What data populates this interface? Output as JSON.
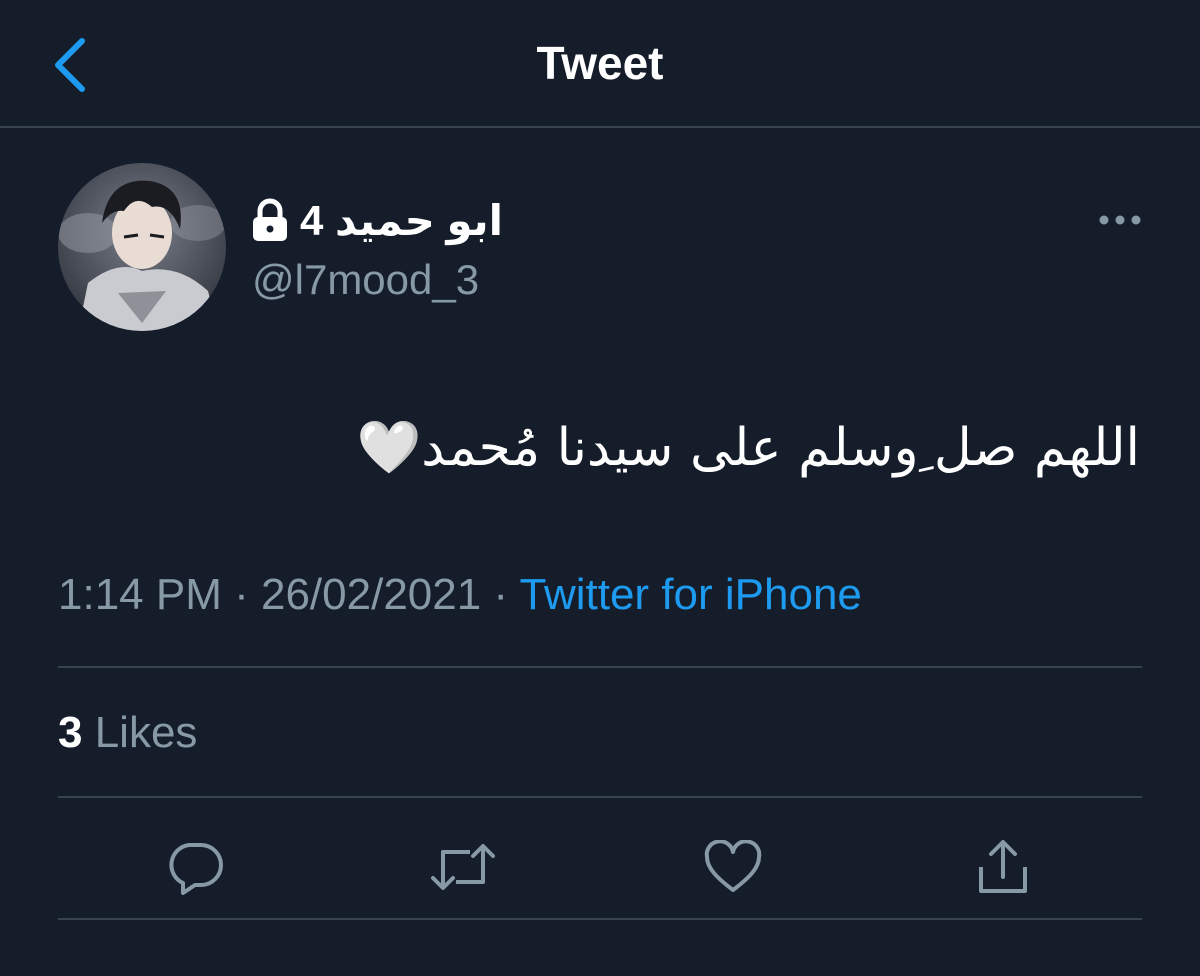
{
  "header": {
    "title": "Tweet",
    "back_icon": "chevron-left-icon"
  },
  "author": {
    "display_name": "ابو حميد 4",
    "handle": "@l7mood_3",
    "protected_icon": "lock-icon",
    "avatar": "anime-character-avatar"
  },
  "tweet": {
    "text": "اللهم صل ِوسلم على سيدنا مُحمد🤍",
    "time": "1:14 PM",
    "separator": " · ",
    "date": "26/02/2021",
    "source": "Twitter for iPhone"
  },
  "stats": {
    "likes_count": "3",
    "likes_label": " Likes"
  },
  "actions": [
    "reply-icon",
    "retweet-icon",
    "like-icon",
    "share-icon"
  ],
  "colors": {
    "background": "#151d2b",
    "accent": "#1d9bf0",
    "secondary_text": "#8899a6",
    "divider": "#38444d"
  }
}
